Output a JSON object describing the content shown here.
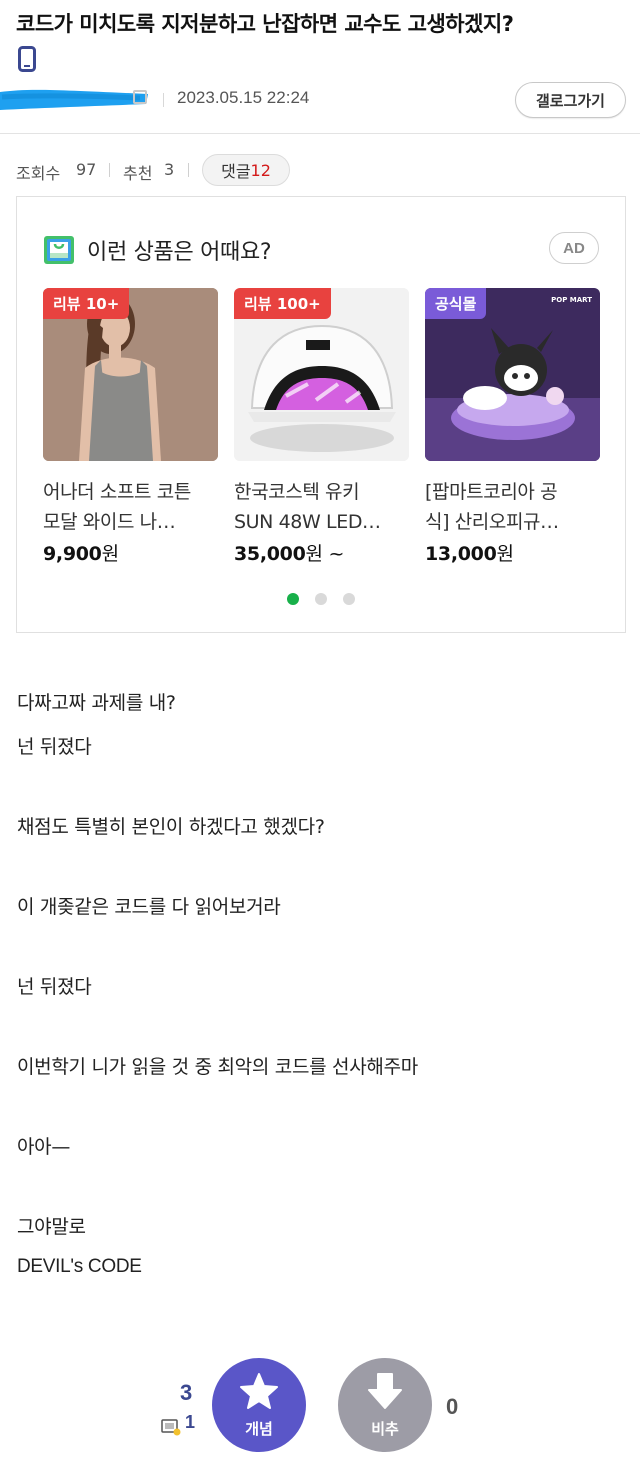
{
  "post": {
    "title": "코드가 미치도록 지저분하고 난잡하면 교수도 고생하겠지?",
    "date": "2023.05.15 22:24",
    "device_icon": "mobile-phone-icon"
  },
  "header": {
    "gallog_button": "갤로그가기"
  },
  "stats": {
    "views_label": "조회수",
    "views": "97",
    "recommend_label": "추천",
    "recommend": "3",
    "comments_label": "댓글",
    "comments": "12"
  },
  "ad": {
    "heading": "이런 상품은 어때요?",
    "badge": "AD",
    "products": [
      {
        "tag": "리뷰 10+",
        "name_line1": "어나더 소프트 코튼",
        "name_line2": "모달 와이드 나…",
        "price": "9,900",
        "price_suffix": "원"
      },
      {
        "tag": "리뷰 100+",
        "name_line1": "한국코스텍 유키",
        "name_line2": "SUN 48W LED…",
        "price": "35,000",
        "price_suffix": "원 ~"
      },
      {
        "tag": "공식몰",
        "name_line1": "[팝마트코리아 공",
        "name_line2": "식] 산리오피규…",
        "price": "13,000",
        "price_suffix": "원",
        "image_text": "POP MART"
      }
    ],
    "carousel_page": 1,
    "carousel_pages": 3
  },
  "body": {
    "lines": [
      "다짜고짜 과제를 내?",
      "넌 뒤졌다",
      "채점도 특별히 본인이 하겠다고 했겠다?",
      "이 개좆같은 코드를 다 읽어보거라",
      "넌 뒤졌다",
      "이번학기 니가 읽을 것 중 최악의 코드를 선사해주마",
      "아아—",
      "그야말로",
      "DEVIL's CODE"
    ]
  },
  "vote": {
    "recommend_count": "3",
    "fixed_recommend_count": "1",
    "recommend_label": "개념",
    "unrecommend_label": "비추",
    "unrecommend_count": "0"
  },
  "colors": {
    "comment_count": "#d31a1a",
    "recommend_button": "#5a56c8",
    "unrecommend_button": "#9d9ca6",
    "carousel_active": "#18b04a",
    "tag_red": "#e8423f",
    "tag_purple": "#7a5bd8"
  }
}
